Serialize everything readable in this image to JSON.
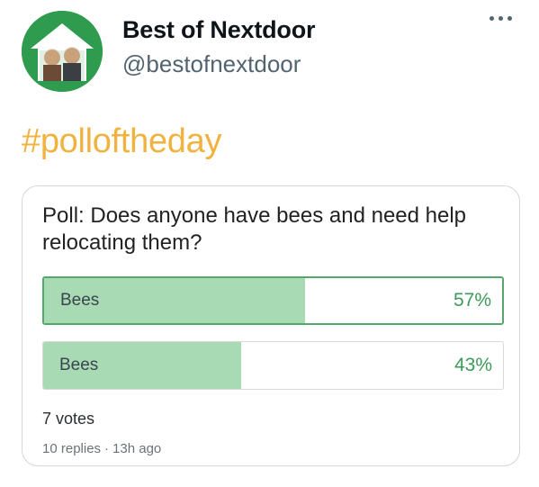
{
  "account": {
    "name": "Best of Nextdoor",
    "handle": "@bestofnextdoor",
    "avatar_icon": "nextdoor-house-avatar-icon",
    "avatar_color": "#2f9b4e"
  },
  "menu_icon": "more-dots-icon",
  "hashtag": "#polloftheday",
  "hashtag_color": "#f1b23f",
  "poll": {
    "question": "Poll: Does anyone have bees and need help relocating them?",
    "options": [
      {
        "label": "Bees",
        "percent_text": "57%",
        "percent": 57,
        "leading": true
      },
      {
        "label": "Bees",
        "percent_text": "43%",
        "percent": 43,
        "leading": false
      }
    ],
    "votes": "7 votes",
    "replies": "10 replies",
    "separator": "·",
    "time": "13h ago",
    "fill_color": "#a8dbb4",
    "percent_color": "#3d9a58"
  }
}
